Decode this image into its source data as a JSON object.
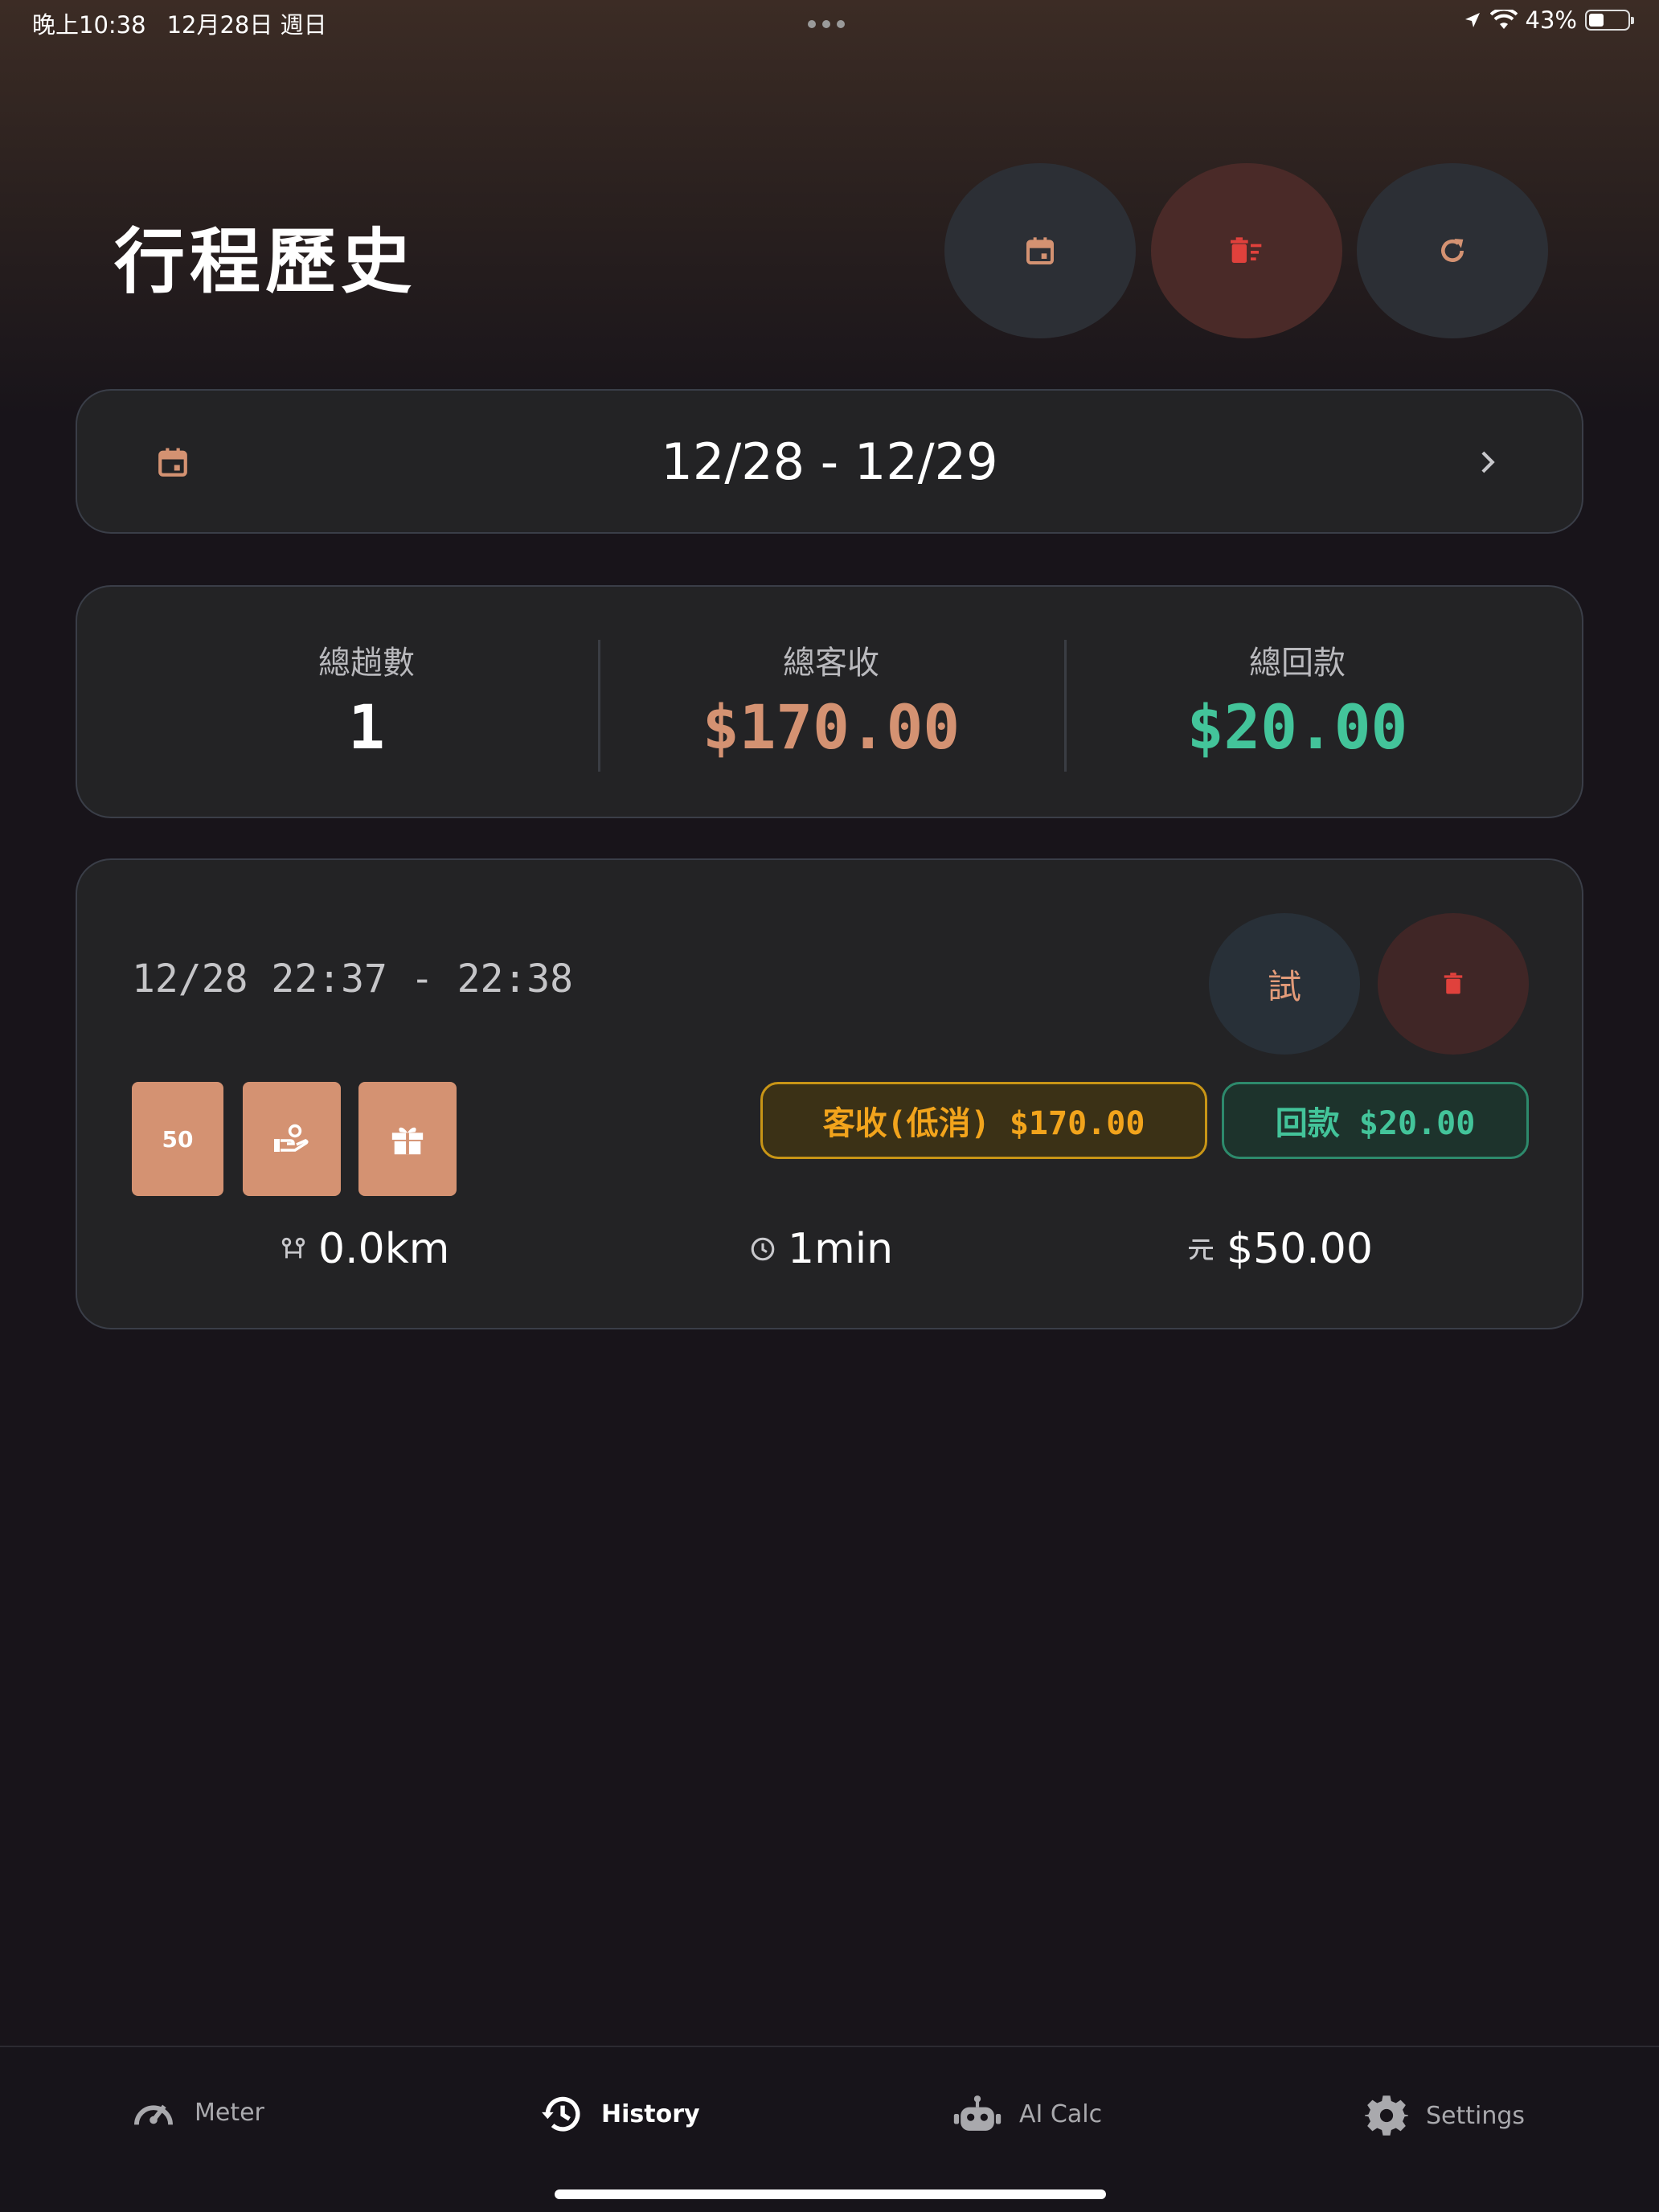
{
  "status_bar": {
    "time": "晚上10:38",
    "date": "12月28日 週日",
    "battery": "43%",
    "battery_level": 0.43
  },
  "header": {
    "title": "行程歷史"
  },
  "date_filter": {
    "range": "12/28 - 12/29"
  },
  "summary": {
    "trips_label": "總趟數",
    "trips_value": "1",
    "fare_label": "總客收",
    "fare_value": "$170.00",
    "refund_label": "總回款",
    "refund_value": "$20.00"
  },
  "trip": {
    "time_range": "12/28 22:37 - 22:38",
    "test_label": "試",
    "tag_value": "50",
    "fare_pill": "客收(低消) $170.00",
    "refund_pill": "回款 $20.00",
    "distance": "0.0km",
    "duration": "1min",
    "amount": "$50.00"
  },
  "tabbar": {
    "meter": "Meter",
    "history": "History",
    "ai_calc": "AI Calc",
    "settings": "Settings"
  },
  "colors": {
    "accent": "#d49272",
    "fare": "#f2a41c",
    "refund": "#43c49a",
    "danger": "#e0413c"
  }
}
